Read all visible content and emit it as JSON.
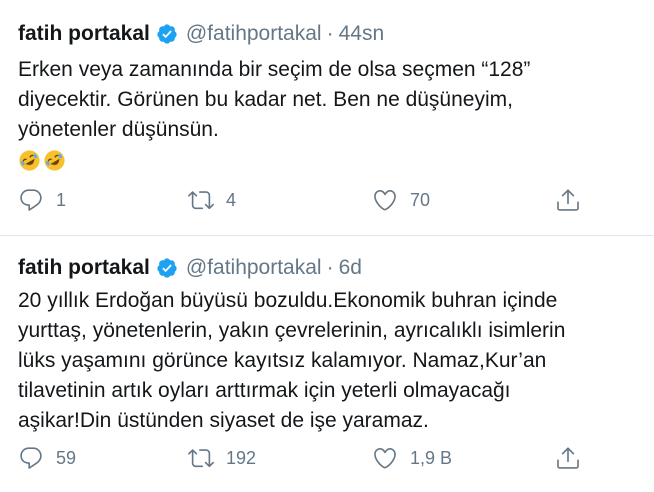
{
  "tweets": [
    {
      "author": "fatih portakal",
      "handle": "@fatihportakal",
      "separator": "·",
      "time": "44sn",
      "lines": [
        "Erken veya zamanında bir seçim de olsa seçmen “128”",
        "diyecektir. Görünen bu kadar net. Ben ne düşüneyim,",
        "yönetenler düşünsün."
      ],
      "emojis": [
        "rolling-on-floor-laughing-emoji",
        "rolling-on-floor-laughing-emoji"
      ],
      "replies": "1",
      "retweets": "4",
      "likes": "70"
    },
    {
      "author": "fatih portakal",
      "handle": "@fatihportakal",
      "separator": "·",
      "time": "6d",
      "lines": [
        "20 yıllık Erdoğan büyüsü bozuldu.Ekonomik buhran içinde",
        "yurttaş, yönetenlerin, yakın çevrelerinin, ayrıcalıklı isimlerin",
        "lüks yaşamını görünce kayıtsız kalamıyor. Namaz,Kur’an",
        "tilavetinin artık oyları arttırmak için yeterli olmayacağı",
        "aşikar!Din üstünden siyaset de işe yaramaz."
      ],
      "replies": "59",
      "retweets": "192",
      "likes": "1,9 B"
    }
  ],
  "icons": {
    "verified": "verified-badge-icon",
    "reply": "reply-icon",
    "retweet": "retweet-icon",
    "like": "heart-icon",
    "share": "share-icon"
  },
  "colors": {
    "verified": "#1da1f2",
    "text": "#14171a",
    "secondary": "#657786",
    "divider": "#e1e8ed"
  }
}
